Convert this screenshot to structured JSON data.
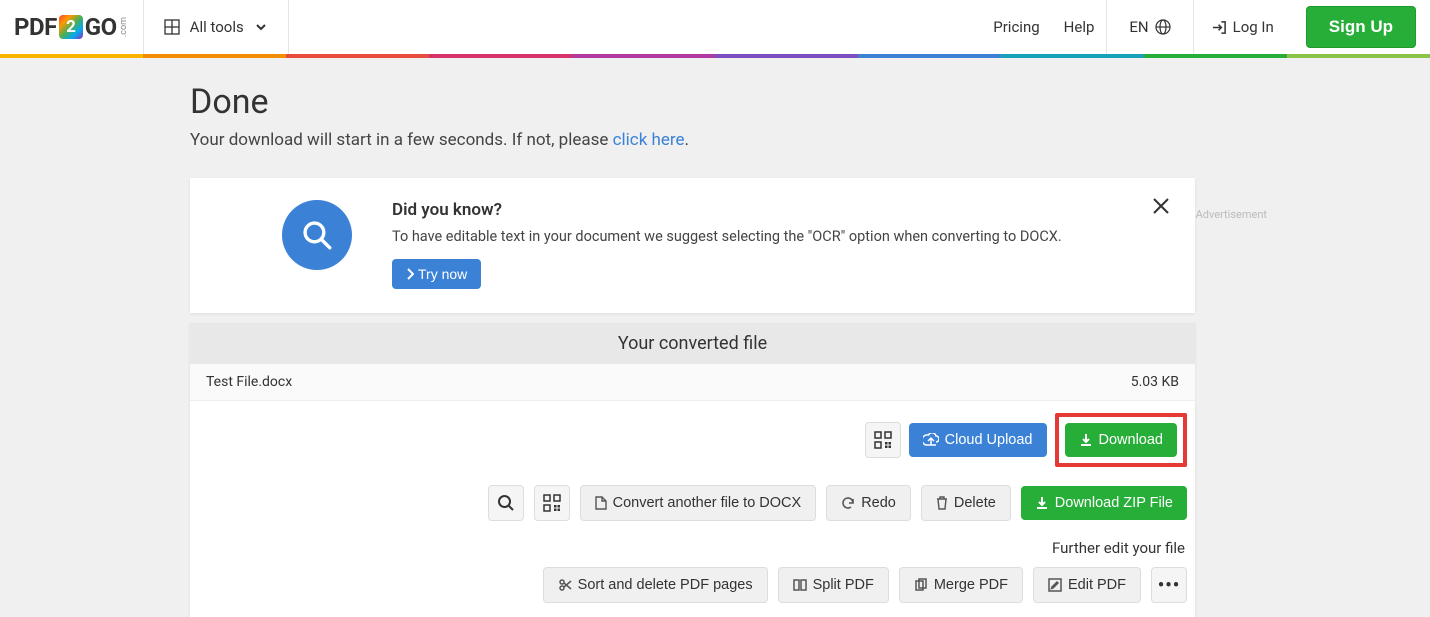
{
  "header": {
    "logo_pre": "PDF",
    "logo_mid": "2",
    "logo_post": "GO",
    "logo_com": ".com",
    "all_tools": "All tools",
    "pricing": "Pricing",
    "help": "Help",
    "lang": "EN",
    "login": "Log In",
    "signup": "Sign Up"
  },
  "rainbow_colors": [
    "#f7b500",
    "#f28c00",
    "#e84c3d",
    "#d6336c",
    "#b03aa2",
    "#7b4fbf",
    "#3b82d6",
    "#17a2b8",
    "#27ae38",
    "#8bc34a"
  ],
  "page": {
    "title": "Done",
    "subtext_pre": "Your download will start in a few seconds. If not, please ",
    "subtext_link": "click here",
    "subtext_post": "."
  },
  "ad_label": "Advertisement",
  "info": {
    "heading": "Did you know?",
    "body": "To have editable text in your document we suggest selecting the \"OCR\" option when converting to DOCX.",
    "try": "Try now"
  },
  "converted": {
    "header": "Your converted file",
    "filename": "Test File.docx",
    "filesize": "5.03 KB"
  },
  "actions": {
    "cloud_upload": "Cloud Upload",
    "download": "Download",
    "convert_another": "Convert another file to DOCX",
    "redo": "Redo",
    "delete": "Delete",
    "download_zip": "Download ZIP File"
  },
  "further": "Further edit your file",
  "edit_actions": {
    "sort_delete": "Sort and delete PDF pages",
    "split": "Split PDF",
    "merge": "Merge PDF",
    "edit": "Edit PDF"
  }
}
